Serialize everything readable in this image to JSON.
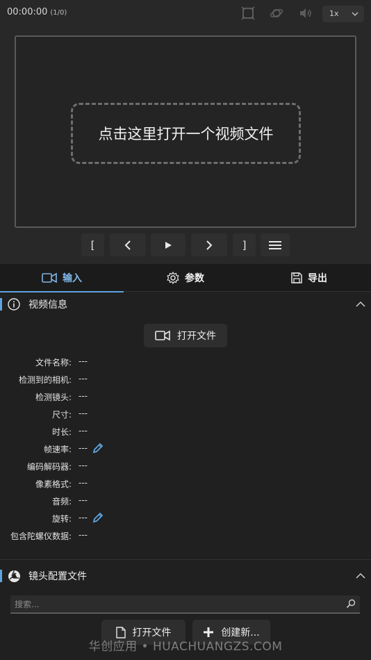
{
  "player": {
    "timecode": "00:00:00",
    "frame_counter": "(1/0)",
    "speed": "1x",
    "open_prompt": "点击这里打开一个视频文件",
    "controls": [
      "[",
      "<",
      "▶",
      ">",
      "]"
    ]
  },
  "tabs": [
    {
      "label": "输入",
      "icon": "video-camera-icon",
      "active": true
    },
    {
      "label": "参数",
      "icon": "gear-icon",
      "active": false
    },
    {
      "label": "导出",
      "icon": "save-icon",
      "active": false
    }
  ],
  "video_info": {
    "title": "视频信息",
    "open_button": "打开文件",
    "rows": [
      {
        "label": "文件名称:",
        "value": "---"
      },
      {
        "label": "检测到的相机:",
        "value": "---"
      },
      {
        "label": "检测镜头:",
        "value": "---"
      },
      {
        "label": "尺寸:",
        "value": "---"
      },
      {
        "label": "时长:",
        "value": "---"
      },
      {
        "label": "帧速率:",
        "value": "---"
      },
      {
        "label": "编码解码器:",
        "value": "---"
      },
      {
        "label": "像素格式:",
        "value": "---"
      },
      {
        "label": "音频:",
        "value": "---"
      },
      {
        "label": "旋转:",
        "value": "---"
      },
      {
        "label": "包含陀螺仪数据:",
        "value": "---"
      }
    ]
  },
  "lens_profile": {
    "title": "镜头配置文件",
    "search_placeholder": "搜索...",
    "open_button": "打开文件",
    "create_button": "创建新..."
  },
  "watermark": "华创应用 • HUACHUANGZS.COM",
  "colors": {
    "accent": "#5ea4e0",
    "background": "#202020"
  }
}
